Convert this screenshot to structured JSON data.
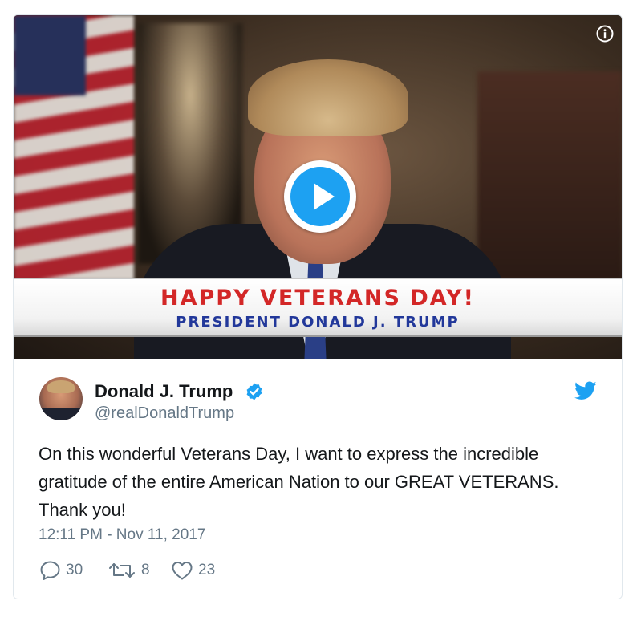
{
  "video": {
    "banner_title": "HAPPY VETERANS DAY!",
    "banner_subtitle": "PRESIDENT DONALD J. TRUMP",
    "play_icon": "play-icon",
    "info_icon": "info-icon"
  },
  "author": {
    "name": "Donald J. Trump",
    "handle": "@realDonaldTrump",
    "verified": true,
    "verified_icon": "verified-badge-icon"
  },
  "tweet": {
    "text": "On this wonderful Veterans Day, I want to express the incredible gratitude of the entire American Nation to our GREAT VETERANS. Thank you!",
    "timestamp": "12:11 PM - Nov 11, 2017"
  },
  "actions": {
    "reply_count": "30",
    "retweet_count": "8",
    "like_count": "23"
  },
  "colors": {
    "brand_blue": "#1da1f2",
    "banner_red": "#d32727",
    "banner_blue": "#22389a",
    "secondary_text": "#657786"
  }
}
